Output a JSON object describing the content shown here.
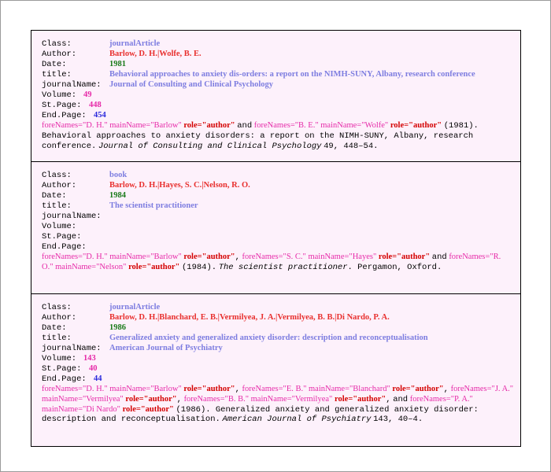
{
  "labels": {
    "class": "Class:",
    "author": "Author:",
    "date": "Date:",
    "title": "title:",
    "journalName": "journalName:",
    "volume": "Volume:",
    "st_page": "St.Page:",
    "end_page": "End.Page:"
  },
  "colors": {
    "class": "#7d7de0",
    "author": "#e8302e",
    "date": "#1a7a1a",
    "title": "#7d7de0",
    "journal": "#7d7de0",
    "volume": "#e62aa8",
    "st_page": "#e62aa8",
    "end_page": "#2a2adc",
    "background": "#fdf1fb"
  },
  "records": [
    {
      "class": "journalArticle",
      "author": "Barlow, D. H.|Wolfe, B. E.",
      "date": "1981",
      "title": "Behavioral approaches to anxiety dis-orders: a report on the NIMH-SUNY, Albany, research conference",
      "journalName": "Journal of Consulting and Clinical Psychology",
      "volume": "49",
      "st_page": "448",
      "end_page": "454",
      "reference": {
        "a1_fore": "foreNames=\"D. H.\" mainName=\"Barlow\"",
        "a1_role": "role=\"author\"",
        "sep1": "and",
        "a2_fore": "foreNames=\"B. E.\" mainName=\"Wolfe\"",
        "a2_role": "role=\"author\"",
        "text1": "(1981). Behavioral approaches to anxiety  disorders: a report on the NIMH-SUNY, Albany, research conference.",
        "journal": "Journal of Consulting and Clinical Psychology",
        "text2": "49, 448–54."
      }
    },
    {
      "class": "book",
      "author": "Barlow, D. H.|Hayes, S. C.|Nelson, R. O.",
      "date": "1984",
      "title": "The scientist practitioner",
      "journalName": "",
      "volume": "",
      "st_page": "",
      "end_page": "",
      "reference": {
        "a1_fore": "foreNames=\"D. H.\" mainName=\"Barlow\"",
        "a1_role": "role=\"author\"",
        "sep1": ",",
        "a2_fore": "foreNames=\"S. C.\" mainName=\"Hayes\"",
        "a2_role": "role=\"author\"",
        "sep2": "and",
        "a3_fore": "foreNames=\"R. O.\" mainName=\"Nelson\"",
        "a3_role": "role=\"author\"",
        "text1": "(1984).",
        "booktitle": "The scientist practitioner",
        "text2": ". Pergamon, Oxford."
      }
    },
    {
      "class": "journalArticle",
      "author": "Barlow, D. H.|Blanchard, E. B.|Vermilyea, J. A.|Vermilyea, B. B.|Di Nardo, P. A.",
      "date": "1986",
      "title": "Generalized anxiety and generalized anxiety disorder: description and reconceptualisation",
      "journalName": "American Journal of Psychiatry",
      "volume": "143",
      "st_page": "40",
      "end_page": "44",
      "reference": {
        "a1_fore": "foreNames=\"D. H.\" mainName=\"Barlow\"",
        "a1_role": "role=\"author\"",
        "sep1": ",",
        "a2_fore": "foreNames=\"E. B.\" mainName=\"Blanchard\"",
        "a2_role": "role=\"author\"",
        "sep2": ",",
        "a3_fore": "foreNames=\"J. A.\" mainName=\"Vermilyea\"",
        "a3_role": "role=\"author\"",
        "sep3": ",",
        "a4_fore": "foreNames=\"B. B.\" mainName=\"Vermilyea\"",
        "a4_role": "role=\"author\"",
        "sep4": ",",
        "sep5": "and",
        "a5_fore": "foreNames=\"P. A.\" mainName=\"Di Nardo\"",
        "a5_role": "role=\"author\"",
        "text1": "(1986). Generalized anxiety and generalized anxiety disorder: description and reconceptualisation.",
        "journal": "American Journal of Psychiatry",
        "text2": "143, 40–4."
      }
    }
  ]
}
